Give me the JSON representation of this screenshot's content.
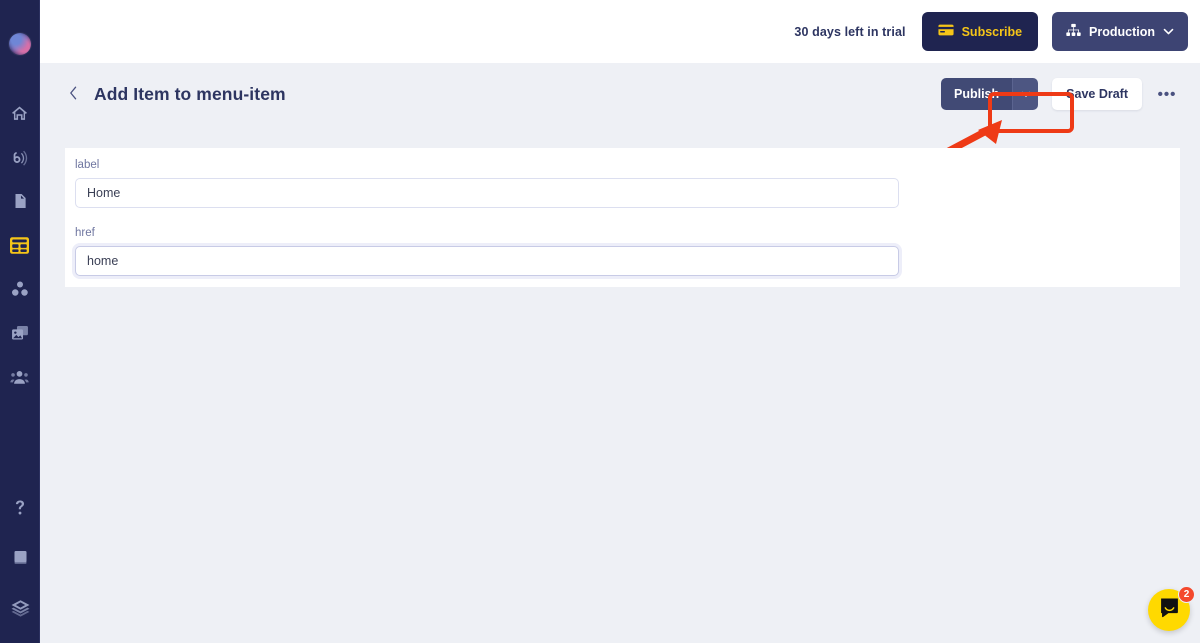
{
  "sidebar": {
    "brand": {
      "name": "workspace-logo"
    },
    "top_items": [
      {
        "icon": "home-icon",
        "name": "sidebar-item-home",
        "active": false
      },
      {
        "icon": "broadcast-icon",
        "name": "sidebar-item-broadcast",
        "active": false
      },
      {
        "icon": "document-icon",
        "name": "sidebar-item-documents",
        "active": false
      },
      {
        "icon": "grid-content-icon",
        "name": "sidebar-item-content",
        "active": true
      },
      {
        "icon": "components-icon",
        "name": "sidebar-item-components",
        "active": false
      },
      {
        "icon": "media-icon",
        "name": "sidebar-item-media",
        "active": false
      },
      {
        "icon": "users-icon",
        "name": "sidebar-item-users",
        "active": false
      }
    ],
    "bottom_items": [
      {
        "icon": "help-icon",
        "name": "sidebar-item-help"
      },
      {
        "icon": "book-icon",
        "name": "sidebar-item-docs"
      },
      {
        "icon": "layers-icon",
        "name": "sidebar-item-layers"
      }
    ]
  },
  "topbar": {
    "trial_text": "30 days left in trial",
    "subscribe_label": "Subscribe",
    "subscribe_icon": "credit-card-icon",
    "environment_label": "Production",
    "environment_icon": "sitemap-icon",
    "environment_chevron": "chevron-down-icon"
  },
  "page_header": {
    "back_icon": "chevron-left-icon",
    "title": "Add Item to menu-item",
    "publish_label": "Publish",
    "publish_caret_icon": "chevron-down-icon",
    "save_draft_label": "Save Draft",
    "more_label": "•••"
  },
  "form": {
    "fields": [
      {
        "label": "label",
        "value": "Home",
        "placeholder": "",
        "focused": false,
        "name": "label-field"
      },
      {
        "label": "href",
        "value": "home",
        "placeholder": "",
        "focused": true,
        "name": "href-field"
      }
    ]
  },
  "chat": {
    "icon": "chat-smile-icon",
    "badge_count": "2"
  },
  "annotation": {
    "highlight_color": "#ee3a16",
    "target": "publish-button"
  },
  "colors": {
    "sidebar_bg": "#1f2450",
    "page_bg": "#eef0f5",
    "accent_yellow": "#f5c518",
    "navy": "#2d3561",
    "publish_bg": "#414a75",
    "chat_yellow": "#ffd900",
    "badge_red": "#f4492d"
  }
}
